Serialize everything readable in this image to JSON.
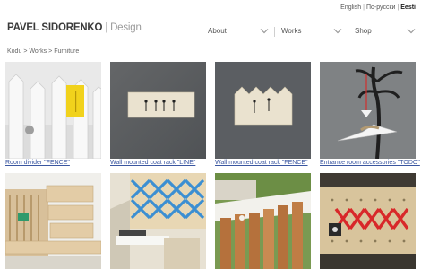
{
  "languages": {
    "english": "English",
    "russian": "По-русски",
    "estonian": "Eesti",
    "separator": "|"
  },
  "logo": {
    "name": "PAVEL SIDORENKO",
    "separator": "|",
    "design": "Design"
  },
  "nav": {
    "items": [
      {
        "label": "About"
      },
      {
        "label": "Works"
      },
      {
        "label": "Shop"
      }
    ]
  },
  "breadcrumb": {
    "items": [
      "Kodu",
      "Works",
      "Furniture"
    ],
    "separator": ">"
  },
  "works": [
    {
      "caption": "Room divider \"FENCE\""
    },
    {
      "caption": "Wall mounted coat rack \"LINE\""
    },
    {
      "caption": "Wall mounted coat rack \"FENCE\""
    },
    {
      "caption": "Entrance room accessories \"TODO\""
    }
  ]
}
